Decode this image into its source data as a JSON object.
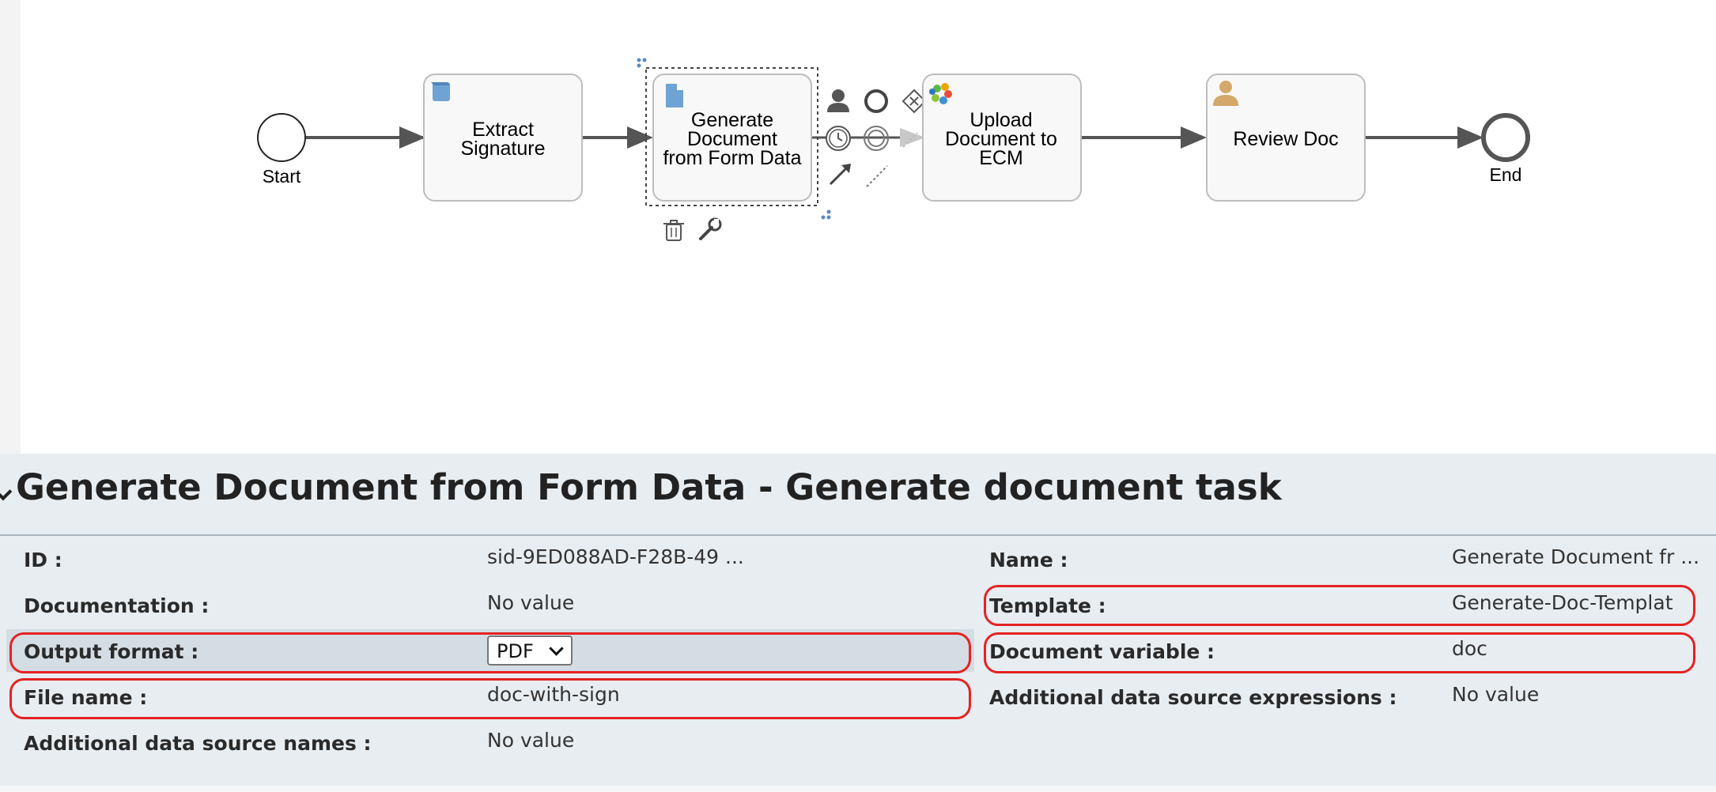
{
  "diagram": {
    "start_label": "Start",
    "end_label": "End",
    "tasks": [
      {
        "line1": "Extract",
        "line2": "Signature",
        "line3": ""
      },
      {
        "line1": "Generate",
        "line2": "Document",
        "line3": "from Form Data"
      },
      {
        "line1": "Upload",
        "line2": "Document to",
        "line3": "ECM"
      },
      {
        "line1": "Review Doc",
        "line2": "",
        "line3": ""
      }
    ],
    "quick_menu": [
      "user-task-icon",
      "end-event-icon",
      "gateway-icon",
      "intermediate-event-icon",
      "boundary-event-icon",
      "sequence-flow-icon",
      "association-icon",
      "delete-icon",
      "properties-wrench-icon"
    ]
  },
  "panel": {
    "title": "Generate Document from Form Data - Generate document task"
  },
  "properties": {
    "left": [
      {
        "label": "ID :",
        "value": "sid-9ED088AD-F28B-49 ..."
      },
      {
        "label": "Documentation :",
        "value": "No value"
      },
      {
        "label": "Output format :",
        "value": "PDF"
      },
      {
        "label": "File name :",
        "value": "doc-with-sign"
      },
      {
        "label": "Additional data source names :",
        "value": "No value"
      }
    ],
    "right": [
      {
        "label": "Name :",
        "value": "Generate Document fr ..."
      },
      {
        "label": "Template :",
        "value": "Generate-Doc-Templat"
      },
      {
        "label": "Document variable :",
        "value": "doc"
      },
      {
        "label": "Additional data source expressions :",
        "value": "No value"
      }
    ]
  },
  "colors": {
    "highlight": "#e52222",
    "panel_bg": "#e8edf1",
    "task_fill": "#f8f8f8",
    "service_icon": "#6fa3d3",
    "user_icon": "#d4a86a"
  }
}
